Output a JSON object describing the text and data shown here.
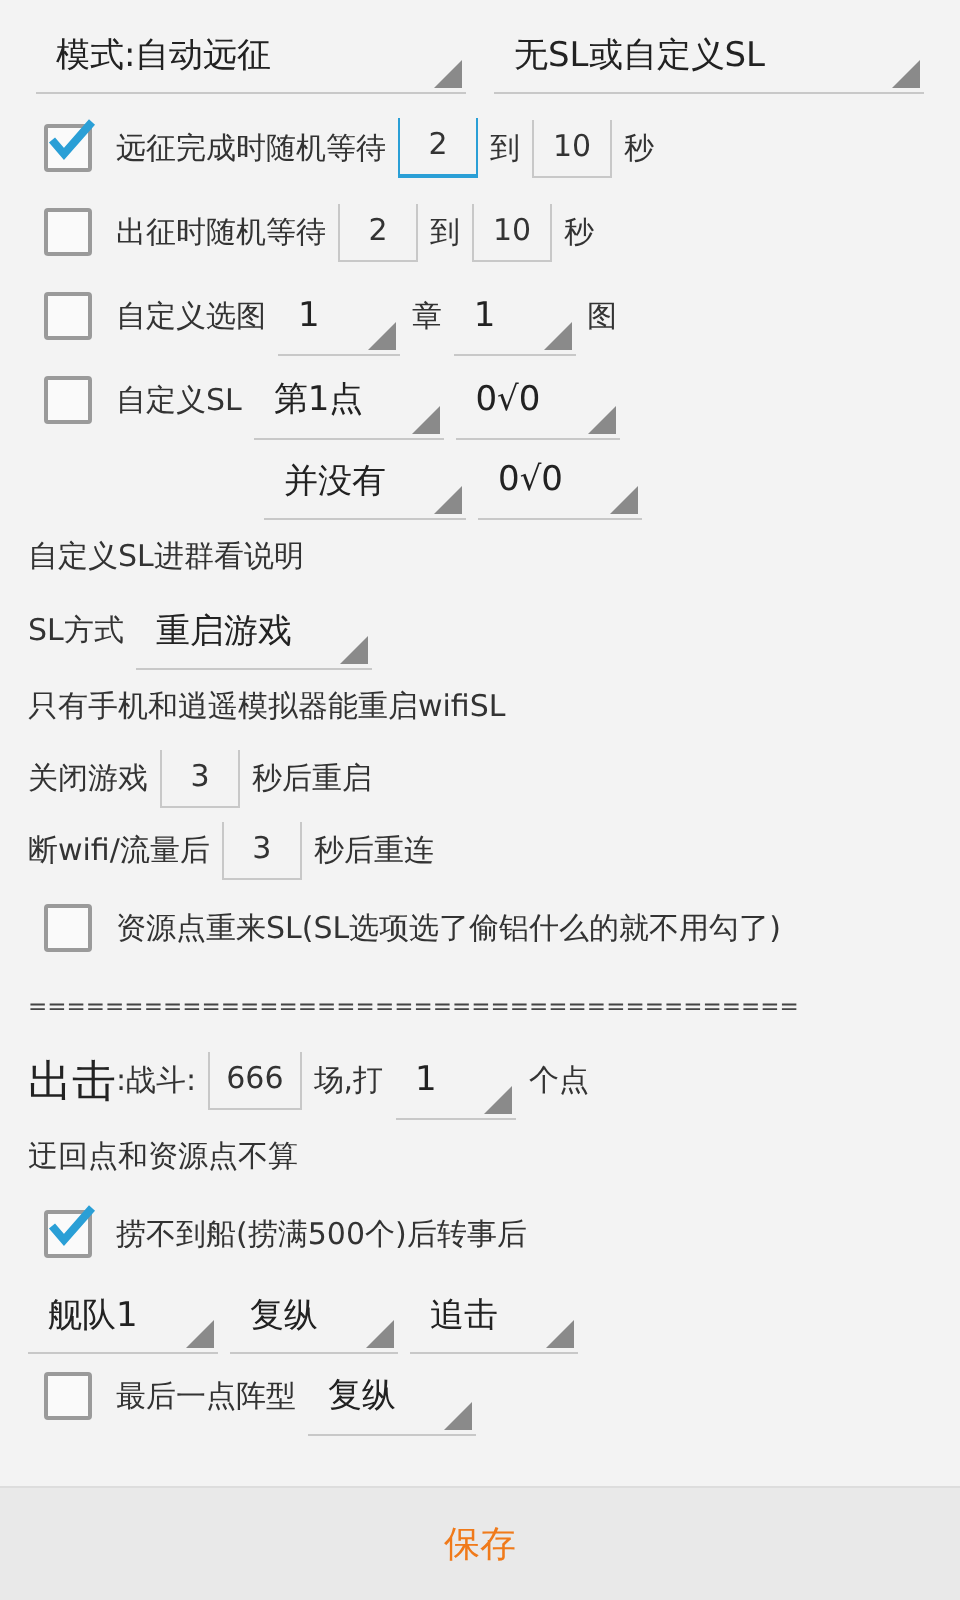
{
  "top_spinners": [
    {
      "value": "模式:自动远征"
    },
    {
      "value": "无SL或自定义SL"
    }
  ],
  "rows": [
    {
      "kind": "check",
      "checked": true,
      "parts": [
        {
          "kind": "text",
          "text": "远征完成时随机等待"
        },
        {
          "kind": "field",
          "value": "2",
          "focused": true
        },
        {
          "kind": "text",
          "text": "到"
        },
        {
          "kind": "field",
          "value": "10",
          "focused": false
        },
        {
          "kind": "text",
          "text": "秒"
        }
      ]
    },
    {
      "kind": "check",
      "checked": false,
      "parts": [
        {
          "kind": "text",
          "text": "出征时随机等待"
        },
        {
          "kind": "field",
          "value": "2",
          "focused": false
        },
        {
          "kind": "text",
          "text": "到"
        },
        {
          "kind": "field",
          "value": "10",
          "focused": false
        },
        {
          "kind": "text",
          "text": "秒"
        }
      ]
    },
    {
      "kind": "check",
      "checked": false,
      "parts": [
        {
          "kind": "text",
          "text": "自定义选图"
        },
        {
          "kind": "spinner",
          "value": "1"
        },
        {
          "kind": "text",
          "text": "章"
        },
        {
          "kind": "spinner",
          "value": "1"
        },
        {
          "kind": "text",
          "text": "图"
        }
      ]
    },
    {
      "kind": "check",
      "checked": false,
      "parts": [
        {
          "kind": "text",
          "text": "自定义SL"
        },
        {
          "kind": "spinner",
          "value": "第1点"
        },
        {
          "kind": "spinner",
          "value": "0√0"
        }
      ]
    },
    {
      "kind": "indented",
      "parts": [
        {
          "kind": "spinner",
          "value": "并没有"
        },
        {
          "kind": "spinner",
          "value": "0√0"
        }
      ]
    },
    {
      "kind": "plain",
      "parts": [
        {
          "kind": "text",
          "text": "自定义SL进群看说明"
        }
      ]
    },
    {
      "kind": "plain",
      "parts": [
        {
          "kind": "text",
          "text": "SL方式"
        },
        {
          "kind": "spinner",
          "value": "重启游戏"
        }
      ]
    },
    {
      "kind": "plain",
      "parts": [
        {
          "kind": "text",
          "text": "只有手机和逍遥模拟器能重启wifiSL"
        }
      ]
    },
    {
      "kind": "plain",
      "parts": [
        {
          "kind": "text",
          "text": "关闭游戏"
        },
        {
          "kind": "field",
          "value": "3",
          "focused": false
        },
        {
          "kind": "text",
          "text": "秒后重启"
        }
      ]
    },
    {
      "kind": "plain",
      "parts": [
        {
          "kind": "text",
          "text": "断wifi/流量后"
        },
        {
          "kind": "field",
          "value": "3",
          "focused": false
        },
        {
          "kind": "text",
          "text": "秒后重连"
        }
      ]
    },
    {
      "kind": "check",
      "checked": false,
      "parts": [
        {
          "kind": "text",
          "text": "资源点重来SL(SL选项选了偷铝什么的就不用勾了)"
        }
      ]
    },
    {
      "kind": "plain",
      "parts": [
        {
          "kind": "separator",
          "text": "========================================"
        }
      ]
    },
    {
      "kind": "plain",
      "parts": [
        {
          "kind": "heading",
          "text": "出击"
        },
        {
          "kind": "text",
          "text": ":战斗:"
        },
        {
          "kind": "field",
          "value": "666",
          "focused": false
        },
        {
          "kind": "text",
          "text": "场,打"
        },
        {
          "kind": "spinner",
          "value": "1"
        },
        {
          "kind": "text",
          "text": "个点"
        }
      ]
    },
    {
      "kind": "plain",
      "parts": [
        {
          "kind": "text",
          "text": "迂回点和资源点不算"
        }
      ]
    },
    {
      "kind": "check",
      "checked": true,
      "parts": [
        {
          "kind": "text",
          "text": "捞不到船(捞满500个)后转事后"
        }
      ]
    },
    {
      "kind": "plain",
      "parts": [
        {
          "kind": "spinner",
          "value": "舰队1"
        },
        {
          "kind": "spinner",
          "value": "复纵"
        },
        {
          "kind": "spinner",
          "value": "追击"
        }
      ]
    },
    {
      "kind": "check",
      "checked": false,
      "parts": [
        {
          "kind": "text",
          "text": "最后一点阵型"
        },
        {
          "kind": "spinner",
          "value": "复纵"
        }
      ]
    }
  ],
  "save_button": "保存"
}
